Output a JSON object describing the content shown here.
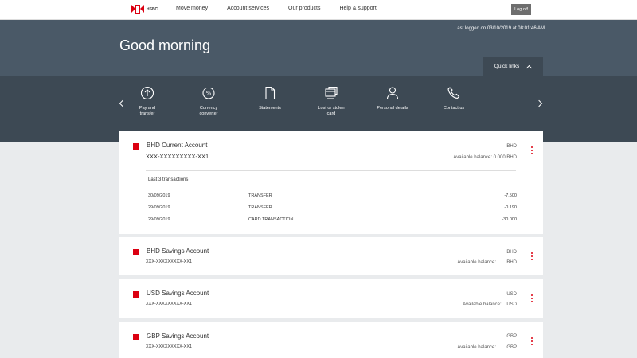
{
  "nav": {
    "logo_text": "HSBC",
    "links": [
      "Move money",
      "Account services",
      "Our products",
      "Help & support"
    ],
    "logoff_label": "Log off"
  },
  "hero": {
    "last_login": "Last logged on 03/10/2019 at 08:01:46 AM",
    "greeting": "Good morning",
    "quick_links_label": "Quick links"
  },
  "quick_links": [
    {
      "label": "Pay and\ntransfer",
      "icon": "pay-transfer-icon"
    },
    {
      "label": "Currency\nconverter",
      "icon": "currency-converter-icon"
    },
    {
      "label": "Statements",
      "icon": "statements-icon"
    },
    {
      "label": "Lost or stolen\ncard",
      "icon": "lost-card-icon"
    },
    {
      "label": "Personal details",
      "icon": "person-icon"
    },
    {
      "label": "Contact us",
      "icon": "phone-icon"
    }
  ],
  "accounts": [
    {
      "name": "BHD Current Account",
      "number": "XXX-XXXXXXXXX-XX1",
      "currency": "BHD",
      "balance_label": "Available balance: 0.000 BHD",
      "last3_label": "Last 3 transactions",
      "transactions": [
        {
          "date": "30/09/2019",
          "type": "TRANSFER",
          "amount": "-7.500"
        },
        {
          "date": "29/09/2019",
          "type": "TRANSFER",
          "amount": "-0.190"
        },
        {
          "date": "29/09/2019",
          "type": "CARD TRANSACTION",
          "amount": "-30.000"
        }
      ]
    },
    {
      "name": "BHD Savings Account",
      "number": "XXX-XXXXXXXXX-XX1",
      "currency": "BHD",
      "balance_label": "Available balance:",
      "balance_cur": "BHD"
    },
    {
      "name": "USD Savings Account",
      "number": "XXX-XXXXXXXXX-XX1",
      "currency": "USD",
      "balance_label": "Available balance:",
      "balance_cur": "USD"
    },
    {
      "name": "GBP Savings Account",
      "number": "XXX-XXXXXXXXX-XX1",
      "currency": "GBP",
      "balance_label": "Available balance:",
      "balance_cur": "GBP"
    }
  ],
  "colors": {
    "brand_red": "#db0011",
    "hero_bg": "#4a5967",
    "strip_bg": "#3d4954"
  }
}
